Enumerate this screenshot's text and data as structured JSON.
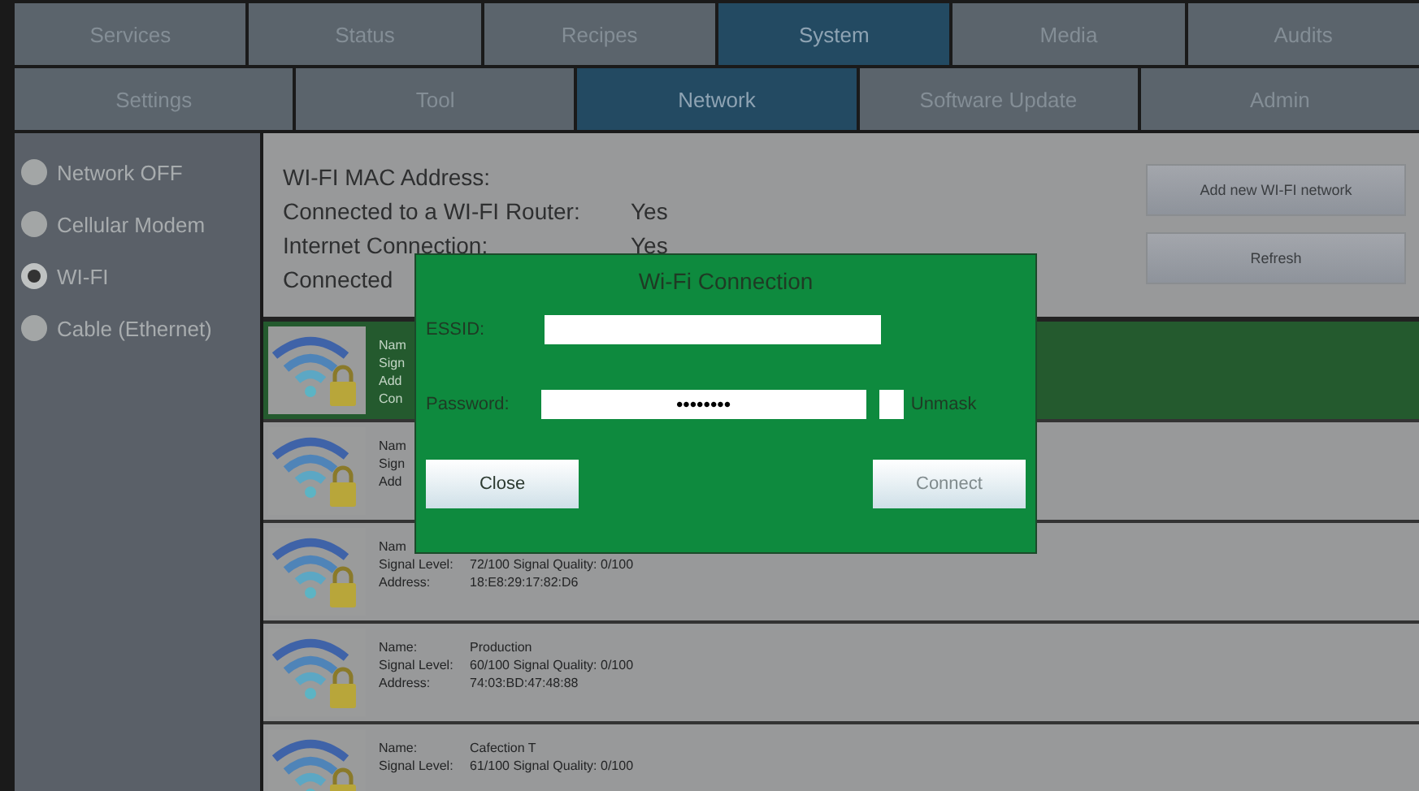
{
  "main_tabs": [
    {
      "label": "Services",
      "selected": false
    },
    {
      "label": "Status",
      "selected": false
    },
    {
      "label": "Recipes",
      "selected": false
    },
    {
      "label": "System",
      "selected": true
    },
    {
      "label": "Media",
      "selected": false
    },
    {
      "label": "Audits",
      "selected": false
    }
  ],
  "sub_tabs": [
    {
      "label": "Settings",
      "selected": false
    },
    {
      "label": "Tool",
      "selected": false
    },
    {
      "label": "Network",
      "selected": true
    },
    {
      "label": "Software Update",
      "selected": false
    },
    {
      "label": "Admin",
      "selected": false
    }
  ],
  "network_modes": [
    {
      "label": "Network OFF",
      "selected": false
    },
    {
      "label": "Cellular Modem",
      "selected": false
    },
    {
      "label": "WI-FI",
      "selected": true
    },
    {
      "label": "Cable (Ethernet)",
      "selected": false
    }
  ],
  "info": [
    {
      "label": "WI-FI MAC Address:"
    },
    {
      "label": "Connected to a WI-FI Router:",
      "value": "Yes"
    },
    {
      "label": "Internet Connection:",
      "value": "Yes"
    },
    {
      "label": "Connected"
    }
  ],
  "buttons": [
    "Add new WI-FI network",
    "Refresh"
  ],
  "networks": [
    {
      "selected": true,
      "lines": [
        {
          "label": "Nam"
        },
        {
          "label": "Sign"
        },
        {
          "label": "Add"
        },
        {
          "label": "Con"
        }
      ]
    },
    {
      "selected": false,
      "lines": [
        {
          "label": "Nam"
        },
        {
          "label": "Sign"
        },
        {
          "label": "Add"
        }
      ]
    },
    {
      "selected": false,
      "lines": [
        {
          "label": "Nam"
        },
        {
          "label": "Signal Level:",
          "value": "72/100  Signal Quality: 0/100"
        },
        {
          "label": "Address:",
          "value": "18:E8:29:17:82:D6"
        }
      ]
    },
    {
      "selected": false,
      "lines": [
        {
          "label": "Name:",
          "value": "Production"
        },
        {
          "label": "Signal Level:",
          "value": "60/100  Signal Quality: 0/100"
        },
        {
          "label": "Address:",
          "value": "74:03:BD:47:48:88"
        }
      ]
    },
    {
      "selected": false,
      "lines": [
        {
          "label": "Name:",
          "value": "Cafection T"
        },
        {
          "label": "Signal Level:",
          "value": "61/100  Signal Quality: 0/100"
        }
      ]
    }
  ],
  "dialog": {
    "title": "Wi-Fi Connection",
    "essid": {
      "label": "ESSID:"
    },
    "password": {
      "label": "Password:",
      "value": "••••••••"
    },
    "unmask": {
      "label": "Unmask",
      "checked": false
    },
    "close": {
      "label": "Close",
      "disabled": false
    },
    "connect": {
      "label": "Connect",
      "disabled": true
    }
  }
}
